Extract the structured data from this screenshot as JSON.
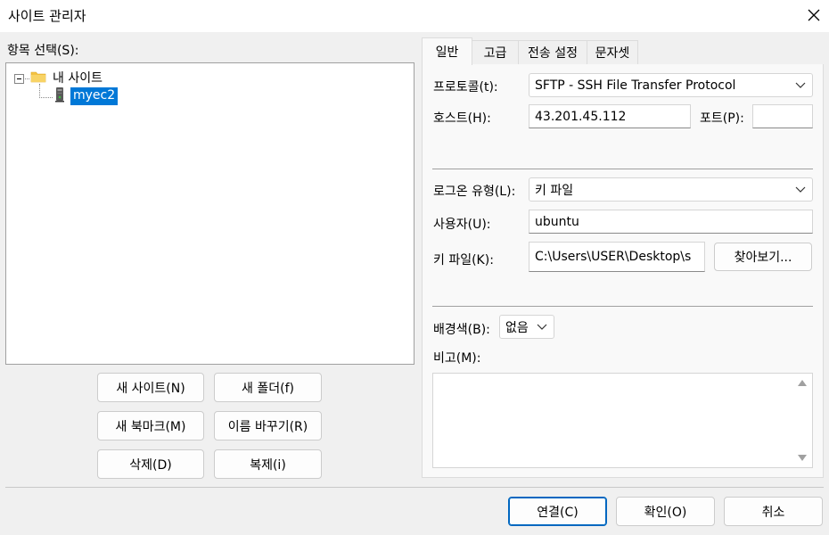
{
  "window": {
    "title": "사이트 관리자",
    "close_icon": "close-icon"
  },
  "tree": {
    "label": "항목 선택(S):",
    "root": {
      "label": "내 사이트",
      "icon": "folder-icon"
    },
    "child": {
      "label": "myec2",
      "icon": "server-icon"
    }
  },
  "left_buttons": {
    "new_site": "새 사이트(N)",
    "new_folder": "새 폴더(f)",
    "new_bookmark": "새 북마크(M)",
    "rename": "이름 바꾸기(R)",
    "delete": "삭제(D)",
    "duplicate": "복제(i)"
  },
  "tabs": [
    "일반",
    "고급",
    "전송 설정",
    "문자셋"
  ],
  "general": {
    "protocol_label": "프로토콜(t):",
    "protocol_value": "SFTP - SSH File Transfer Protocol",
    "host_label": "호스트(H):",
    "host_value": "43.201.45.112",
    "port_label": "포트(P):",
    "port_value": "",
    "logon_label": "로그온 유형(L):",
    "logon_value": "키 파일",
    "user_label": "사용자(U):",
    "user_value": "ubuntu",
    "keyfile_label": "키 파일(K):",
    "keyfile_value": "C:\\Users\\USER\\Desktop\\s",
    "browse_label": "찾아보기...",
    "bgcolor_label": "배경색(B):",
    "bgcolor_value": "없음",
    "comments_label": "비고(M):"
  },
  "footer": {
    "connect": "연결(C)",
    "ok": "확인(O)",
    "cancel": "취소"
  },
  "colors": {
    "selection": "#0078d7",
    "primary_border": "#0067c0",
    "folder": "#f4c243"
  }
}
